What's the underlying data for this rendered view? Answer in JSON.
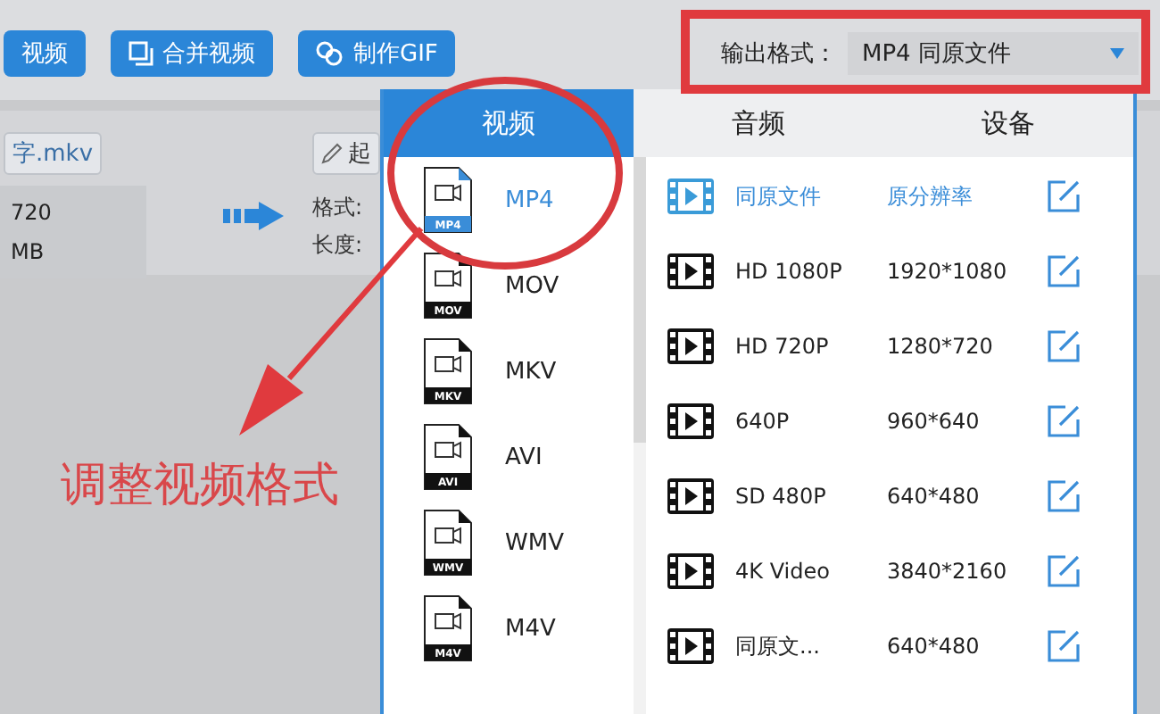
{
  "toolbar": {
    "buttons": [
      {
        "label": "视频",
        "kind": "plain"
      },
      {
        "label": "合并视频",
        "kind": "merge"
      },
      {
        "label": "制作GIF",
        "kind": "gif"
      }
    ],
    "output_format": {
      "label": "输出格式：",
      "value": "MP4  同原文件"
    }
  },
  "file": {
    "name": "字.mkv",
    "resolution": "720",
    "size": "MB",
    "edit_label": "起",
    "format_label": "格式:",
    "length_label": "长度:"
  },
  "dropdown": {
    "tabs": [
      {
        "label": "视频",
        "selected": true
      },
      {
        "label": "音频",
        "selected": false
      },
      {
        "label": "设备",
        "selected": false
      }
    ],
    "formats": [
      {
        "label": "MP4",
        "badge": "MP4",
        "selected": true
      },
      {
        "label": "MOV",
        "badge": "MOV",
        "selected": false
      },
      {
        "label": "MKV",
        "badge": "MKV",
        "selected": false
      },
      {
        "label": "AVI",
        "badge": "AVI",
        "selected": false
      },
      {
        "label": "WMV",
        "badge": "WMV",
        "selected": false
      },
      {
        "label": "M4V",
        "badge": "M4V",
        "selected": false
      }
    ],
    "presets": [
      {
        "name": "同原文件",
        "resolution": "原分辨率",
        "selected": true
      },
      {
        "name": "HD 1080P",
        "resolution": "1920*1080",
        "selected": false
      },
      {
        "name": "HD 720P",
        "resolution": "1280*720",
        "selected": false
      },
      {
        "name": "640P",
        "resolution": "960*640",
        "selected": false
      },
      {
        "name": "SD 480P",
        "resolution": "640*480",
        "selected": false
      },
      {
        "name": "4K Video",
        "resolution": "3840*2160",
        "selected": false
      },
      {
        "name": "同原文...",
        "resolution": "640*480",
        "selected": false
      }
    ]
  },
  "annotation": {
    "text": "调整视频格式"
  }
}
